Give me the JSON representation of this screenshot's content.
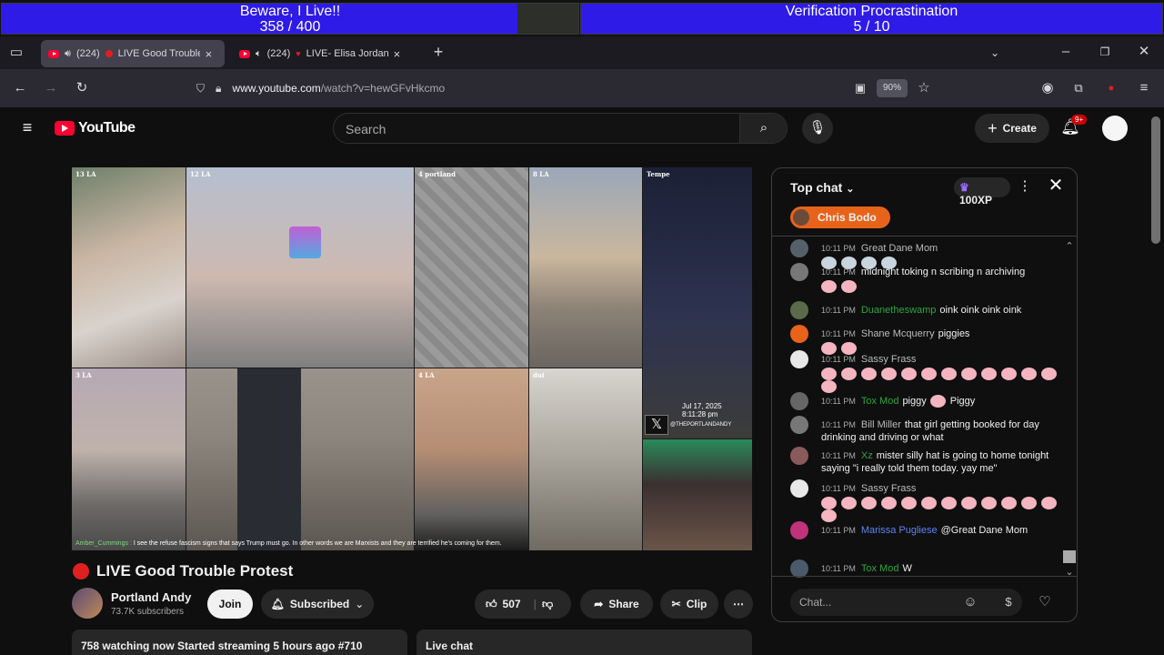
{
  "overlay": {
    "left_bar": {
      "title": "Beware, I Live!!",
      "progress": "358 / 400",
      "fill": 0.895
    },
    "right_bar": {
      "title": "Verification Procrastination",
      "progress": "5 / 10",
      "fill": 1.0
    }
  },
  "browser": {
    "tabs": [
      {
        "count": "(224)",
        "label": "LIVE Good Trouble",
        "active": true
      },
      {
        "count": "(224)",
        "label": "LIVE- Elisa Jordan",
        "active": false
      }
    ],
    "new_tab": "+",
    "url_host": "www.youtube.com",
    "url_path": "/watch?v=hewGFvHkcmo",
    "zoom": "90%"
  },
  "youtube": {
    "logo": "YouTube",
    "search_placeholder": "Search",
    "create_label": "Create",
    "notifications_badge": "9+"
  },
  "video": {
    "tiles": [
      "13 LA",
      "12 LA",
      "4 portland",
      "8 LA",
      "Tempe",
      "3 LA",
      "4 LA",
      "dui"
    ],
    "overlay_date": "Jul 17, 2025",
    "overlay_time": "8:11:28 pm",
    "overlay_handle": "@THEPORTLANDANDY",
    "caption_user": "Amber_Cummings :",
    "caption_text": "I see the refuse fascism signs that says Trump must go. In other words we are Marxists and they are terrified he's coming for them."
  },
  "meta": {
    "title": "LIVE Good Trouble Protest",
    "channel": "Portland Andy",
    "subscribers": "73.7K subscribers",
    "join": "Join",
    "subscribed": "Subscribed",
    "likes": "507",
    "share": "Share",
    "clip": "Clip",
    "stats": "758 watching now  Started streaming 5 hours ago  #710",
    "live_chat": "Live chat"
  },
  "chat": {
    "mode": "Top chat",
    "xp": "100XP",
    "pinned": "Chris Bodo",
    "input_placeholder": "Chat...",
    "messages": [
      {
        "time": "10:11 PM",
        "author": "Great Dane Mom",
        "text": "",
        "style": "",
        "emoji": 4,
        "emoji_color": "#c8d4de"
      },
      {
        "time": "10:11 PM",
        "author": "",
        "text": "midnight toking n scribing n archiving",
        "style": "",
        "emoji": 2,
        "emoji_color": "#f4b4c0"
      },
      {
        "time": "10:11 PM",
        "author": "Duanetheswamp",
        "text": "oink oink oink oink",
        "style": "green",
        "emoji": 0,
        "emoji_color": ""
      },
      {
        "time": "10:11 PM",
        "author": "Shane Mcquerry",
        "text": "piggies",
        "style": "",
        "emoji": 2,
        "emoji_color": "#f4b4c0"
      },
      {
        "time": "10:11 PM",
        "author": "Sassy Frass",
        "text": "",
        "style": "",
        "emoji": 5,
        "emoji_color": "#f4b4c0"
      },
      {
        "time": "10:11 PM",
        "author": "Tox Mod",
        "text": "piggy",
        "style": "green",
        "emoji": 1,
        "emoji_color": "#f4b4c0"
      },
      {
        "time": "10:11 PM",
        "author": "Bill Miller",
        "text": "that girl getting booked for day drinking and driving or what",
        "style": "",
        "emoji": 0,
        "emoji_color": ""
      },
      {
        "time": "10:11 PM",
        "author": "Xz",
        "text": "mister silly hat is going to home tonight saying \"i really told them today. yay me\"",
        "style": "green",
        "emoji": 0,
        "emoji_color": ""
      },
      {
        "time": "10:11 PM",
        "author": "Sassy Frass",
        "text": "",
        "style": "",
        "emoji": 5,
        "emoji_color": "#f4b4c0"
      },
      {
        "time": "10:11 PM",
        "author": "Marissa Pugliese",
        "text": "@Great Dane Mom",
        "style": "blue",
        "emoji": 0,
        "emoji_color": ""
      },
      {
        "time": "10:11 PM",
        "author": "Tox Mod",
        "text": "W",
        "style": "green",
        "emoji": 0,
        "emoji_color": ""
      }
    ],
    "piggy_word": "Piggy"
  }
}
